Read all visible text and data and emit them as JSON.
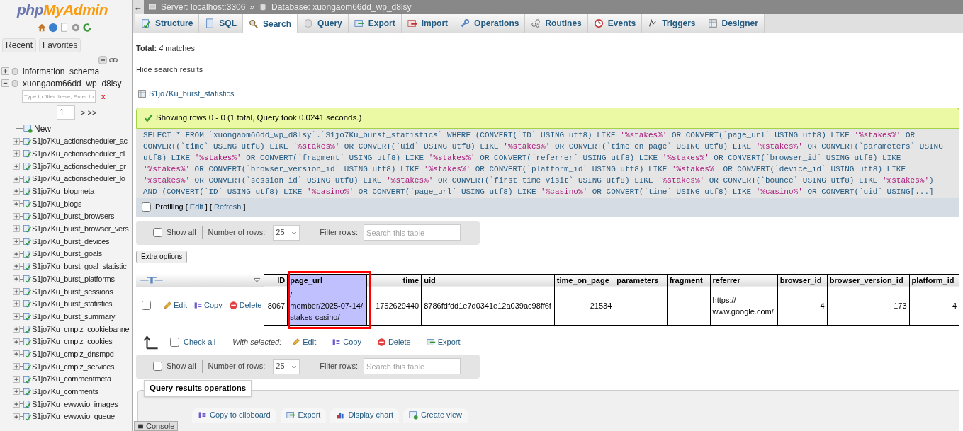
{
  "logo": {
    "part_1": "php",
    "part_2": "MyAdmin"
  },
  "sidebar": {
    "tabs": [
      "Recent",
      "Favorites"
    ],
    "databases": [
      {
        "name": "information_schema",
        "expanded": false
      },
      {
        "name": "xuongaom66dd_wp_d8lsy",
        "expanded": true,
        "filter_placeholder": "Type to filter these, Enter to",
        "clear": "x",
        "page": "1",
        "next": "> >>",
        "tables": [
          {
            "name": "New",
            "kind": "new"
          },
          {
            "name": "S1jo7Ku_actionscheduler_ac",
            "kind": "table"
          },
          {
            "name": "S1jo7Ku_actionscheduler_cl",
            "kind": "table"
          },
          {
            "name": "S1jo7Ku_actionscheduler_gr",
            "kind": "table"
          },
          {
            "name": "S1jo7Ku_actionscheduler_lo",
            "kind": "table"
          },
          {
            "name": "S1jo7Ku_blogmeta",
            "kind": "table"
          },
          {
            "name": "S1jo7Ku_blogs",
            "kind": "table"
          },
          {
            "name": "S1jo7Ku_burst_browsers",
            "kind": "table"
          },
          {
            "name": "S1jo7Ku_burst_browser_vers",
            "kind": "table"
          },
          {
            "name": "S1jo7Ku_burst_devices",
            "kind": "table"
          },
          {
            "name": "S1jo7Ku_burst_goals",
            "kind": "table"
          },
          {
            "name": "S1jo7Ku_burst_goal_statistic",
            "kind": "table"
          },
          {
            "name": "S1jo7Ku_burst_platforms",
            "kind": "table"
          },
          {
            "name": "S1jo7Ku_burst_sessions",
            "kind": "table"
          },
          {
            "name": "S1jo7Ku_burst_statistics",
            "kind": "table"
          },
          {
            "name": "S1jo7Ku_burst_summary",
            "kind": "table"
          },
          {
            "name": "S1jo7Ku_cmplz_cookiebanne",
            "kind": "table"
          },
          {
            "name": "S1jo7Ku_cmplz_cookies",
            "kind": "table"
          },
          {
            "name": "S1jo7Ku_cmplz_dnsmpd",
            "kind": "table"
          },
          {
            "name": "S1jo7Ku_cmplz_services",
            "kind": "table"
          },
          {
            "name": "S1jo7Ku_commentmeta",
            "kind": "table"
          },
          {
            "name": "S1jo7Ku_comments",
            "kind": "table"
          },
          {
            "name": "S1jo7Ku_ewwwio_images",
            "kind": "table"
          },
          {
            "name": "S1jo7Ku_ewwwio_queue",
            "kind": "table"
          }
        ]
      }
    ]
  },
  "breadcrumb": {
    "back": "←",
    "separator": "»",
    "items": [
      "Server: localhost:3306",
      "Database: xuongaom66dd_wp_d8lsy"
    ]
  },
  "tabs": [
    {
      "label": "Structure",
      "selected": false
    },
    {
      "label": "SQL",
      "selected": false
    },
    {
      "label": "Search",
      "selected": true
    },
    {
      "label": "Query",
      "selected": false
    },
    {
      "label": "Export",
      "selected": false
    },
    {
      "label": "Import",
      "selected": false
    },
    {
      "label": "Operations",
      "selected": false
    },
    {
      "label": "Routines",
      "selected": false
    },
    {
      "label": "Events",
      "selected": false
    },
    {
      "label": "Triggers",
      "selected": false
    },
    {
      "label": "Designer",
      "selected": false
    }
  ],
  "total": "**Total:** *4* matches",
  "hide_results": "Hide search results",
  "table_link": "S1jo7Ku_burst_statistics",
  "success_message": "Showing rows 0 - 0 (1 total, Query took 0.0241 seconds.)",
  "sql": "SELECT * FROM `xuongaom66dd_wp_d8lsy`.`S1jo7Ku_burst_statistics` WHERE (CONVERT(`ID` USING utf8) LIKE '%stakes%' OR CONVERT(`page_url` USING utf8) LIKE '%stakes%' OR CONVERT(`time` USING utf8) LIKE '%stakes%' OR CONVERT(`uid` USING utf8) LIKE '%stakes%' OR CONVERT(`time_on_page` USING utf8) LIKE '%stakes%' OR CONVERT(`parameters` USING utf8) LIKE '%stakes%' OR CONVERT(`fragment` USING utf8) LIKE '%stakes%' OR CONVERT(`referrer` USING utf8) LIKE '%stakes%' OR CONVERT(`browser_id` USING utf8) LIKE '%stakes%' OR CONVERT(`browser_version_id` USING utf8) LIKE '%stakes%' OR CONVERT(`platform_id` USING utf8) LIKE '%stakes%' OR CONVERT(`device_id` USING utf8) LIKE '%stakes%' OR CONVERT(`session_id` USING utf8) LIKE '%stakes%' OR CONVERT(`first_time_visit` USING utf8) LIKE '%stakes%' OR CONVERT(`bounce` USING utf8) LIKE '%stakes%') AND (CONVERT(`ID` USING utf8) LIKE '%casino%' OR CONVERT(`page_url` USING utf8) LIKE '%casino%' OR CONVERT(`time` USING utf8) LIKE '%casino%' OR CONVERT(`uid` USING[...]",
  "profiling": {
    "label": "Profiling",
    "checked": false,
    "open": "[",
    "edit": "Edit",
    "mid": "] [",
    "refresh": "Refresh",
    "close": "]"
  },
  "nav_bars": [
    {
      "show_all": "Show all",
      "checked": false,
      "rows_label": "Number of rows:",
      "rows_value": "25",
      "filter_label": "Filter rows:",
      "filter_placeholder": "Search this table"
    },
    {
      "show_all": "Show all",
      "checked": false,
      "rows_label": "Number of rows:",
      "rows_value": "25",
      "filter_label": "Filter rows:",
      "filter_placeholder": "Search this table"
    }
  ],
  "extra_options": "Extra options",
  "results": {
    "columns": [
      {
        "label": "ID",
        "highlighted": false,
        "marked": false
      },
      {
        "label": "page_url",
        "highlighted": true,
        "marked": true
      },
      {
        "label": "time",
        "highlighted": false,
        "marked": false
      },
      {
        "label": "uid",
        "highlighted": false,
        "marked": false
      },
      {
        "label": "time_on_page",
        "highlighted": false,
        "marked": false
      },
      {
        "label": "parameters",
        "highlighted": false,
        "marked": false
      },
      {
        "label": "fragment",
        "highlighted": false,
        "marked": false
      },
      {
        "label": "referrer",
        "highlighted": false,
        "marked": false
      },
      {
        "label": "browser_id",
        "highlighted": false,
        "marked": false
      },
      {
        "label": "browser_version_id",
        "highlighted": false,
        "marked": false
      },
      {
        "label": "platform_id",
        "highlighted": false,
        "marked": false
      }
    ],
    "rows": [
      {
        "checked": false,
        "actions": [
          "Edit",
          "Copy",
          "Delete"
        ],
        "cells": [
          "8067",
          "/\nmember/2025-07-14/\nstakes-casino/",
          "1752629440",
          "8786fdfdd1e7d0341e12a039ac98ff6f",
          "21534",
          "",
          "",
          "https://\nwww.google.com/",
          "4",
          "173",
          "4"
        ]
      }
    ]
  },
  "with_selected": {
    "check_all": "Check all",
    "checked": false,
    "label": "With selected:",
    "actions": [
      "Edit",
      "Copy",
      "Delete",
      "Export"
    ]
  },
  "query_operations": {
    "title": "Query results operations",
    "actions": [
      "Copy to clipboard",
      "Export",
      "Display chart",
      "Create view"
    ]
  },
  "console": "Console"
}
